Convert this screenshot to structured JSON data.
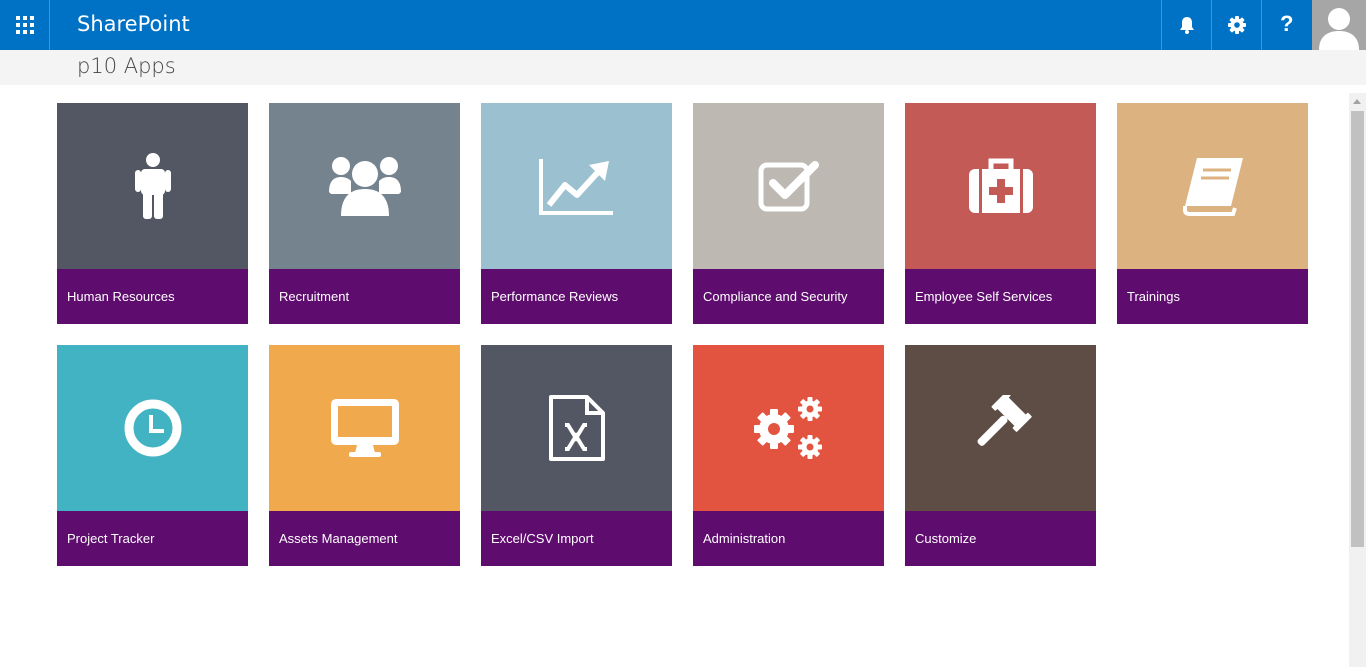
{
  "suitebar": {
    "brand": "SharePoint",
    "app_launcher_icon": "waffle-icon",
    "notifications_icon": "bell-icon",
    "settings_icon": "gear-icon",
    "help_label": "?",
    "color": "#0072c6"
  },
  "site": {
    "title": "p10 Apps"
  },
  "tiles": [
    {
      "label": "Human Resources",
      "icon": "person-icon",
      "color": "#535663"
    },
    {
      "label": "Recruitment",
      "icon": "users-icon",
      "color": "#75838f"
    },
    {
      "label": "Performance Reviews",
      "icon": "line-chart-icon",
      "color": "#9bc0cf"
    },
    {
      "label": "Compliance and Security",
      "icon": "checkbox-icon",
      "color": "#beb8b3"
    },
    {
      "label": "Employee Self Services",
      "icon": "medkit-icon",
      "color": "#c35a56"
    },
    {
      "label": "Trainings",
      "icon": "book-icon",
      "color": "#dcb380"
    },
    {
      "label": "Project Tracker",
      "icon": "clock-icon",
      "color": "#41b3c2"
    },
    {
      "label": "Assets Management",
      "icon": "monitor-icon",
      "color": "#f0a94d"
    },
    {
      "label": "Excel/CSV Import",
      "icon": "excel-file-icon",
      "color": "#535663"
    },
    {
      "label": "Administration",
      "icon": "gears-icon",
      "color": "#e25440"
    },
    {
      "label": "Customize",
      "icon": "gavel-icon",
      "color": "#5e4d45"
    }
  ],
  "tile_label_color": "#5e0c6e"
}
